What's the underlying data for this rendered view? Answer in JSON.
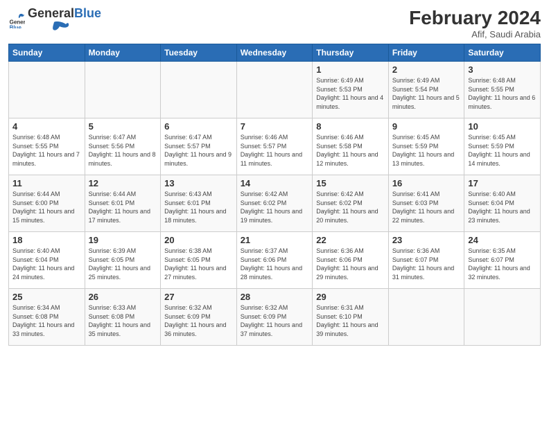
{
  "header": {
    "logo_general": "General",
    "logo_blue": "Blue",
    "month_title": "February 2024",
    "subtitle": "Afif, Saudi Arabia"
  },
  "days_of_week": [
    "Sunday",
    "Monday",
    "Tuesday",
    "Wednesday",
    "Thursday",
    "Friday",
    "Saturday"
  ],
  "weeks": [
    [
      {
        "day": "",
        "info": ""
      },
      {
        "day": "",
        "info": ""
      },
      {
        "day": "",
        "info": ""
      },
      {
        "day": "",
        "info": ""
      },
      {
        "day": "1",
        "info": "Sunrise: 6:49 AM\nSunset: 5:53 PM\nDaylight: 11 hours and 4 minutes."
      },
      {
        "day": "2",
        "info": "Sunrise: 6:49 AM\nSunset: 5:54 PM\nDaylight: 11 hours and 5 minutes."
      },
      {
        "day": "3",
        "info": "Sunrise: 6:48 AM\nSunset: 5:55 PM\nDaylight: 11 hours and 6 minutes."
      }
    ],
    [
      {
        "day": "4",
        "info": "Sunrise: 6:48 AM\nSunset: 5:55 PM\nDaylight: 11 hours and 7 minutes."
      },
      {
        "day": "5",
        "info": "Sunrise: 6:47 AM\nSunset: 5:56 PM\nDaylight: 11 hours and 8 minutes."
      },
      {
        "day": "6",
        "info": "Sunrise: 6:47 AM\nSunset: 5:57 PM\nDaylight: 11 hours and 9 minutes."
      },
      {
        "day": "7",
        "info": "Sunrise: 6:46 AM\nSunset: 5:57 PM\nDaylight: 11 hours and 11 minutes."
      },
      {
        "day": "8",
        "info": "Sunrise: 6:46 AM\nSunset: 5:58 PM\nDaylight: 11 hours and 12 minutes."
      },
      {
        "day": "9",
        "info": "Sunrise: 6:45 AM\nSunset: 5:59 PM\nDaylight: 11 hours and 13 minutes."
      },
      {
        "day": "10",
        "info": "Sunrise: 6:45 AM\nSunset: 5:59 PM\nDaylight: 11 hours and 14 minutes."
      }
    ],
    [
      {
        "day": "11",
        "info": "Sunrise: 6:44 AM\nSunset: 6:00 PM\nDaylight: 11 hours and 15 minutes."
      },
      {
        "day": "12",
        "info": "Sunrise: 6:44 AM\nSunset: 6:01 PM\nDaylight: 11 hours and 17 minutes."
      },
      {
        "day": "13",
        "info": "Sunrise: 6:43 AM\nSunset: 6:01 PM\nDaylight: 11 hours and 18 minutes."
      },
      {
        "day": "14",
        "info": "Sunrise: 6:42 AM\nSunset: 6:02 PM\nDaylight: 11 hours and 19 minutes."
      },
      {
        "day": "15",
        "info": "Sunrise: 6:42 AM\nSunset: 6:02 PM\nDaylight: 11 hours and 20 minutes."
      },
      {
        "day": "16",
        "info": "Sunrise: 6:41 AM\nSunset: 6:03 PM\nDaylight: 11 hours and 22 minutes."
      },
      {
        "day": "17",
        "info": "Sunrise: 6:40 AM\nSunset: 6:04 PM\nDaylight: 11 hours and 23 minutes."
      }
    ],
    [
      {
        "day": "18",
        "info": "Sunrise: 6:40 AM\nSunset: 6:04 PM\nDaylight: 11 hours and 24 minutes."
      },
      {
        "day": "19",
        "info": "Sunrise: 6:39 AM\nSunset: 6:05 PM\nDaylight: 11 hours and 25 minutes."
      },
      {
        "day": "20",
        "info": "Sunrise: 6:38 AM\nSunset: 6:05 PM\nDaylight: 11 hours and 27 minutes."
      },
      {
        "day": "21",
        "info": "Sunrise: 6:37 AM\nSunset: 6:06 PM\nDaylight: 11 hours and 28 minutes."
      },
      {
        "day": "22",
        "info": "Sunrise: 6:36 AM\nSunset: 6:06 PM\nDaylight: 11 hours and 29 minutes."
      },
      {
        "day": "23",
        "info": "Sunrise: 6:36 AM\nSunset: 6:07 PM\nDaylight: 11 hours and 31 minutes."
      },
      {
        "day": "24",
        "info": "Sunrise: 6:35 AM\nSunset: 6:07 PM\nDaylight: 11 hours and 32 minutes."
      }
    ],
    [
      {
        "day": "25",
        "info": "Sunrise: 6:34 AM\nSunset: 6:08 PM\nDaylight: 11 hours and 33 minutes."
      },
      {
        "day": "26",
        "info": "Sunrise: 6:33 AM\nSunset: 6:08 PM\nDaylight: 11 hours and 35 minutes."
      },
      {
        "day": "27",
        "info": "Sunrise: 6:32 AM\nSunset: 6:09 PM\nDaylight: 11 hours and 36 minutes."
      },
      {
        "day": "28",
        "info": "Sunrise: 6:32 AM\nSunset: 6:09 PM\nDaylight: 11 hours and 37 minutes."
      },
      {
        "day": "29",
        "info": "Sunrise: 6:31 AM\nSunset: 6:10 PM\nDaylight: 11 hours and 39 minutes."
      },
      {
        "day": "",
        "info": ""
      },
      {
        "day": "",
        "info": ""
      }
    ]
  ]
}
